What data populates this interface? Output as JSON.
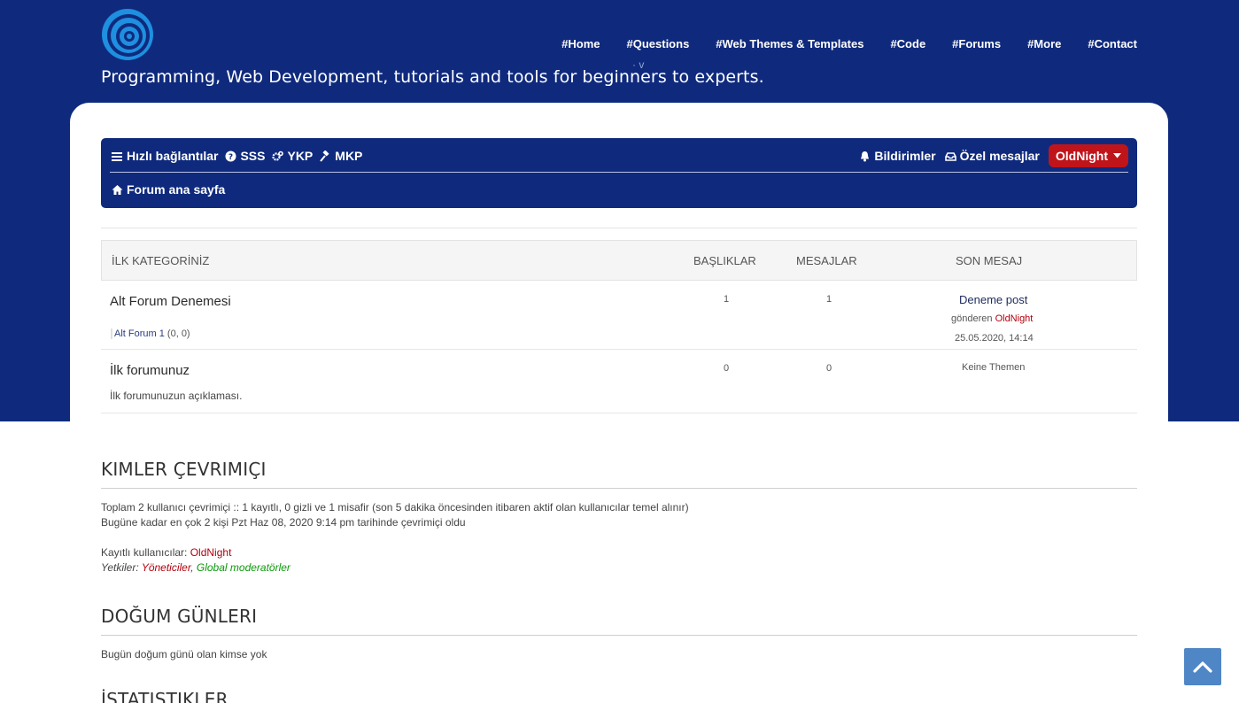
{
  "header": {
    "tagline": "Programming, Web Development, tutorials and tools for beginners to experts.",
    "tiny_mark": "· v",
    "nav": [
      "#Home",
      "#Questions",
      "#Web Themes & Templates",
      "#Code",
      "#Forums",
      "#More",
      "#Contact"
    ]
  },
  "forum_nav": {
    "quick_links": "Hızlı bağlantılar",
    "faq": "SSS",
    "acp": "YKP",
    "mcp": "MKP",
    "notifications": "Bildirimler",
    "private_messages": "Özel mesajlar",
    "user": "OldNight",
    "breadcrumb_home": "Forum ana sayfa"
  },
  "forum_table": {
    "headers": {
      "category": "İLK KATEGORİNİZ",
      "topics": "BAŞLIKLAR",
      "posts": "MESAJLAR",
      "last_post": "SON MESAJ"
    },
    "rows": [
      {
        "name": "Alt Forum Denemesi",
        "subforum": "Alt Forum 1",
        "subforum_counts": "(0, 0)",
        "topics": "1",
        "posts": "1",
        "last_title": "Deneme post",
        "last_by_label": "gönderen",
        "last_by_user": "OldNight",
        "last_date": "25.05.2020, 14:14"
      },
      {
        "name": "İlk forumunuz",
        "description": "İlk forumunuzun açıklaması.",
        "topics": "0",
        "posts": "0",
        "no_topics": "Keine Themen"
      }
    ]
  },
  "online": {
    "title": "KIMLER ÇEVRIMIÇI",
    "line1": "Toplam 2 kullanıcı çevrimiçi :: 1 kayıtlı, 0 gizli ve 1 misafir (son 5 dakika öncesinden itibaren aktif olan kullanıcılar temel alınır)",
    "line2": "Bugüne kadar en çok 2 kişi Pzt Haz 08, 2020 9:14 pm tarihinde çevrimiçi oldu",
    "registered_label": "Kayıtlı kullanıcılar:",
    "registered_user": "OldNight",
    "legend_label": "Yetkiler:",
    "legend_admins": "Yöneticiler",
    "legend_sep": ",",
    "legend_mods": "Global moderatörler"
  },
  "birthdays": {
    "title": "DOĞUM GÜNLERI",
    "text": "Bugün doğum günü olan kimse yok"
  },
  "statistics": {
    "title": "İSTATISTIKLER"
  },
  "colors": {
    "header_bg": "#0f2a7d",
    "user_badge": "#c0141b",
    "scroll_top": "#4f86c6"
  }
}
